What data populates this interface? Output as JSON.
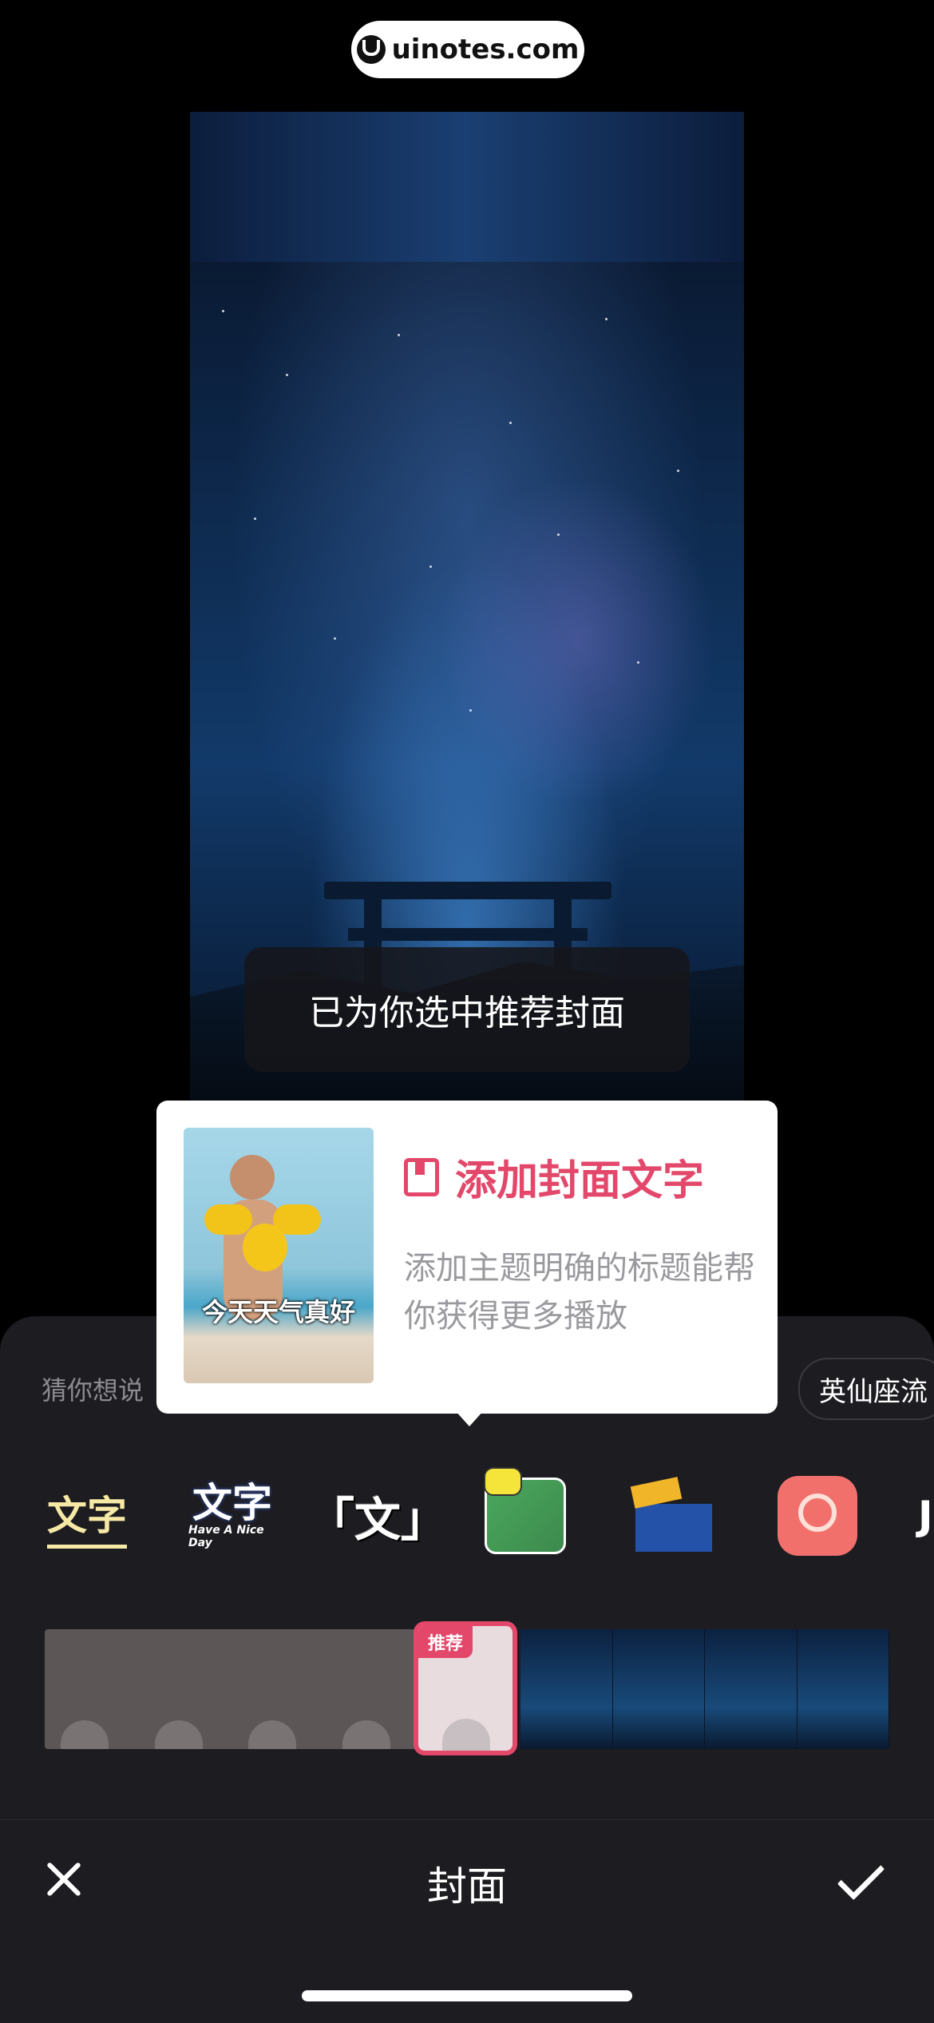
{
  "watermark": {
    "text": "uinotes.com",
    "icon": "uinotes-logo"
  },
  "toast": {
    "text": "已为你选中推荐封面"
  },
  "popup": {
    "thumbnail_caption": "今天天气真好",
    "title": "添加封面文字",
    "title_icon": "bookmark-icon",
    "description": "添加主题明确的标题能帮你获得更多播放",
    "accent_color": "#e3486b"
  },
  "suggestions": {
    "label": "猜你想说",
    "chip": "英仙座流"
  },
  "text_styles": [
    {
      "label": "文字"
    },
    {
      "label": "文字",
      "sublabel": "Have A Nice Day"
    },
    {
      "label": "「文」"
    },
    {
      "icon": "green-card-sticker-icon"
    },
    {
      "icon": "blue-board-sticker-icon"
    },
    {
      "icon": "camera-sticker-icon"
    },
    {
      "label": "J"
    }
  ],
  "timeline": {
    "recommended_badge": "推荐"
  },
  "bottom_bar": {
    "title": "封面",
    "close_icon": "close-icon",
    "confirm_icon": "checkmark-icon"
  }
}
